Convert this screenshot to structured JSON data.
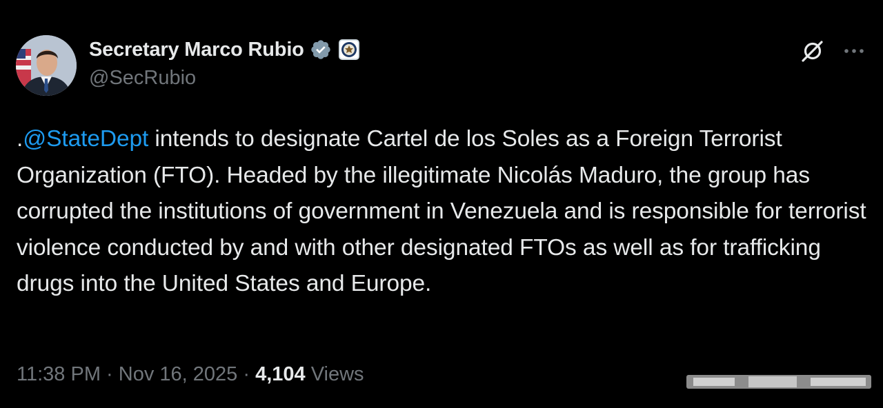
{
  "author": {
    "display_name": "Secretary Marco Rubio",
    "handle": "@SecRubio",
    "verified_icon": "verified-badge-icon",
    "affiliation_icon": "state-department-seal-icon"
  },
  "actions": {
    "grok_icon": "grok-icon",
    "more_icon": "more-options-icon"
  },
  "tweet": {
    "prefix": ".",
    "mention": "@StateDept",
    "text": " intends to designate Cartel de los Soles as a Foreign Terrorist Organization (FTO). Headed by the illegitimate Nicolás Maduro, the group has corrupted the institutions of government in Venezuela and is responsible for terrorist violence conducted by and with other designated FTOs as well as for trafficking drugs into the United States and Europe."
  },
  "meta": {
    "time": "11:38 PM",
    "sep1": " · ",
    "date": "Nov 16, 2025",
    "sep2": " · ",
    "views_count": "4,104",
    "views_label": " Views"
  },
  "colors": {
    "background": "#000000",
    "text": "#e7e9ea",
    "secondary": "#71767b",
    "link": "#1d9bf0",
    "verified": "#829aab"
  }
}
